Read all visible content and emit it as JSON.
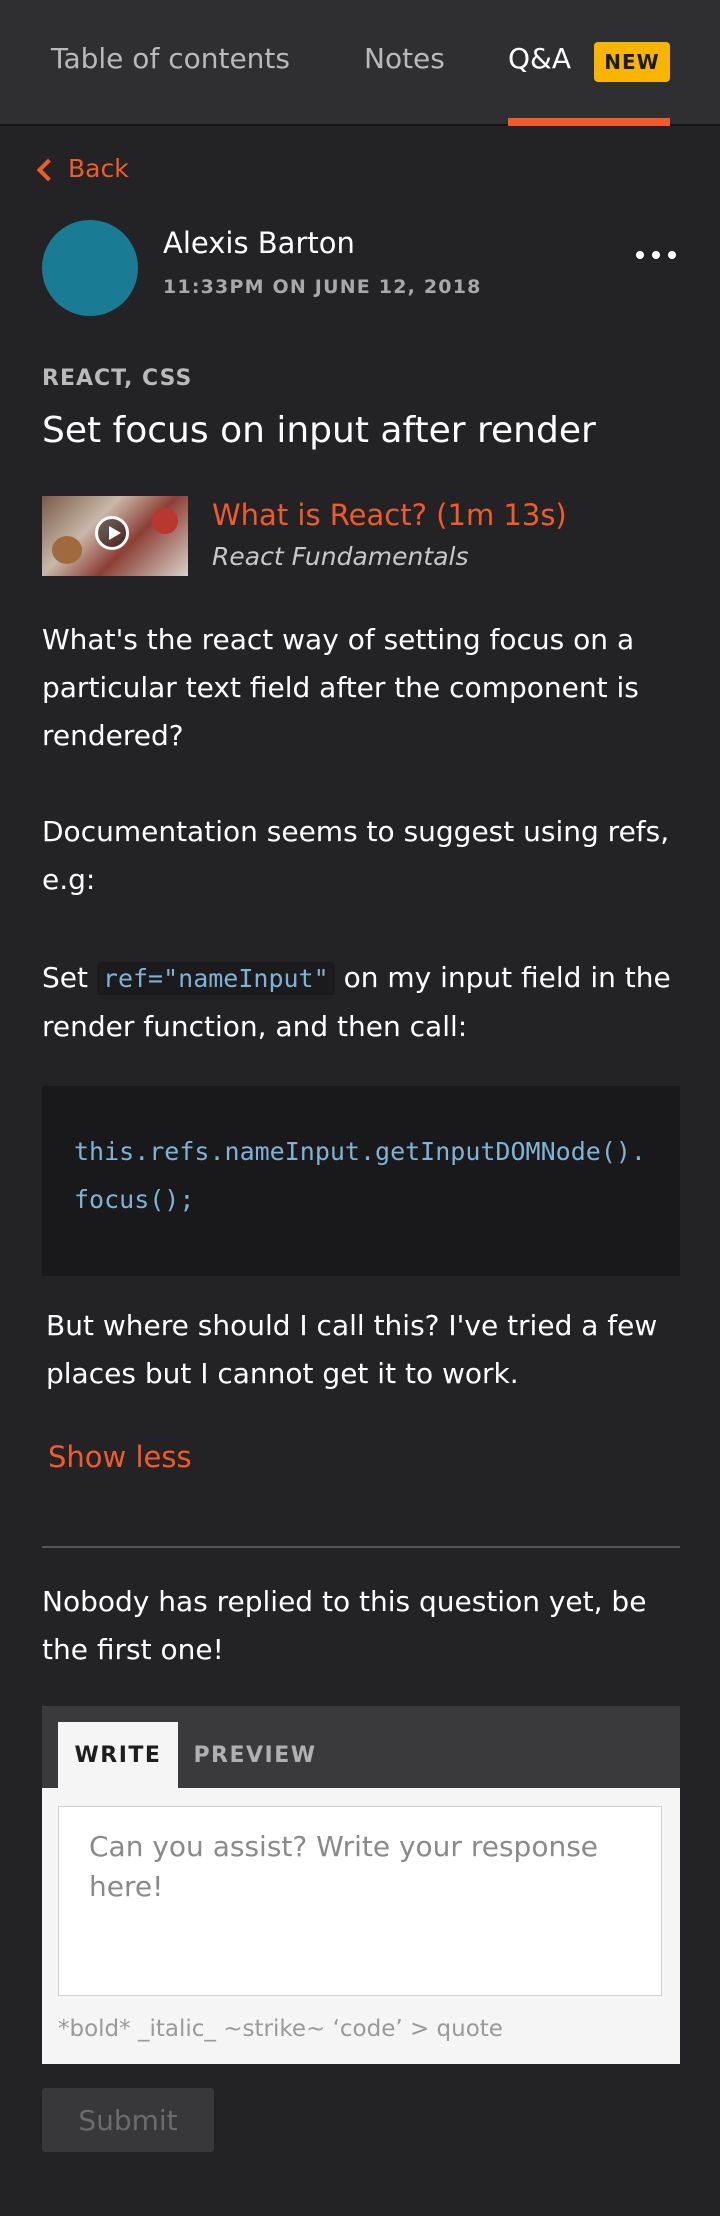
{
  "tabs": {
    "toc": "Table of contents",
    "notes": "Notes",
    "qa": "Q&A",
    "qa_badge": "NEW"
  },
  "back_label": "Back",
  "post": {
    "author": "Alexis Barton",
    "timestamp": "11:33PM ON JUNE 12, 2018",
    "tags": "REACT, CSS",
    "title": "Set focus on input after render",
    "clip": {
      "title": "What is React? (1m 13s)",
      "course": "React Fundamentals"
    },
    "body": {
      "p1": "What's the react way of setting focus on a particular text field after the component is rendered?",
      "p2": "Documentation seems to suggest using refs, e.g:",
      "p3_pre": "Set",
      "p3_code": "ref=\"nameInput\"",
      "p3_post": "on my input field in the render function, and then call:",
      "code": "this.refs.nameInput.getInputDOMNode().focus();",
      "p4": "But where should I call this? I've tried a few places but I cannot get it to work."
    },
    "show_less": "Show less"
  },
  "replies": {
    "empty_text": "Nobody has replied to this question yet, be the first one!"
  },
  "editor": {
    "tab_write": "WRITE",
    "tab_preview": "PREVIEW",
    "placeholder": "Can you assist? Write your response here!",
    "hints": "*bold*  _italic_  ~strike~  ‘code’  > quote",
    "submit": "Submit"
  },
  "colors": {
    "accent": "#f15b2a",
    "badge": "#f7b500",
    "avatar": "#1a7b95"
  }
}
